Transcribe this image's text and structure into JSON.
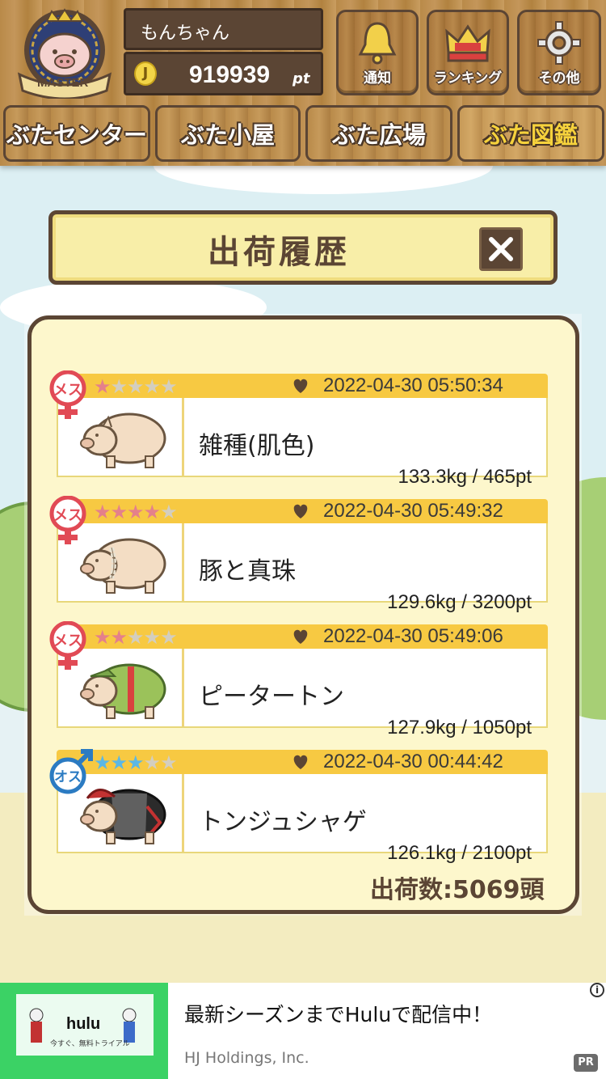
{
  "header": {
    "badge_text": "MASTER",
    "username": "もんちゃん",
    "coin_symbol": "J",
    "points": "919939",
    "points_unit": "pt",
    "buttons": [
      {
        "label": "通知",
        "icon": "bell-icon"
      },
      {
        "label": "ランキング",
        "icon": "crown-icon"
      },
      {
        "label": "その他",
        "icon": "gear-icon"
      }
    ]
  },
  "nav": {
    "tabs": [
      "ぶたセンター",
      "ぶた小屋",
      "ぶた広場",
      "ぶた図鑑"
    ],
    "active": "ぶた図鑑"
  },
  "dialog": {
    "title": "出荷履歴",
    "close_icon": "close-icon",
    "records": [
      {
        "gender": "メス",
        "gender_symbol": "♀",
        "stars": 1,
        "date": "2022-04-30 05:50:34",
        "name": "雑種(肌色)",
        "weight": "133.3kg / 465pt"
      },
      {
        "gender": "メス",
        "gender_symbol": "♀",
        "stars": 4,
        "date": "2022-04-30 05:49:32",
        "name": "豚と真珠",
        "weight": "129.6kg / 3200pt"
      },
      {
        "gender": "メス",
        "gender_symbol": "♀",
        "stars": 2,
        "date": "2022-04-30 05:49:06",
        "name": "ピータートン",
        "weight": "127.9kg / 1050pt"
      },
      {
        "gender": "オス",
        "gender_symbol": "♂",
        "stars": 3,
        "date": "2022-04-30 00:44:42",
        "name": "トンジュシャゲ",
        "weight": "126.1kg / 2100pt"
      }
    ],
    "total": "出荷数:5069頭"
  },
  "ad": {
    "brand": "hulu",
    "tagline": "今すぐ、無料トライアル",
    "title": "最新シーズンまでHuluで配信中！",
    "advertiser": "HJ Holdings, Inc.",
    "info_symbol": "i",
    "pr_label": "PR"
  },
  "colors": {
    "wood": "#b98a49",
    "dark_brown": "#5b4534",
    "gold_strip": "#f7c942",
    "panel": "#fdf7cc",
    "female": "#e14a55",
    "male": "#2b7bc2"
  }
}
